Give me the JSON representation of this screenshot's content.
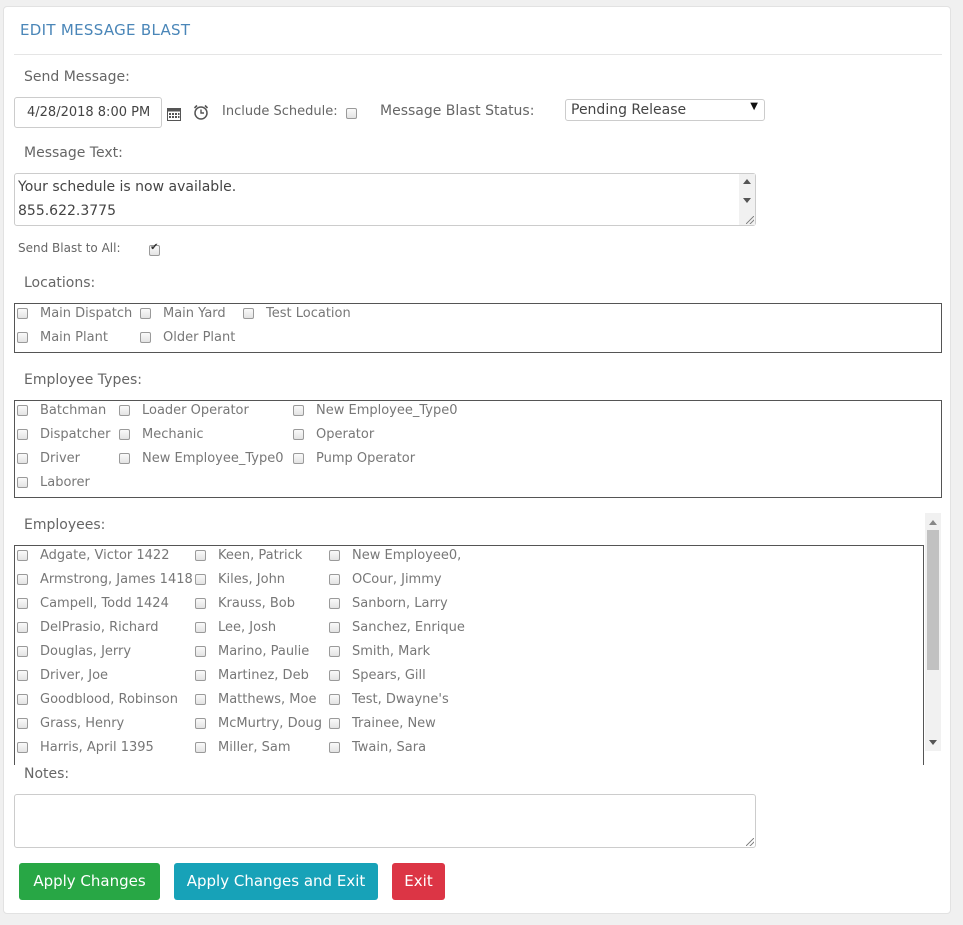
{
  "header": {
    "title": "EDIT MESSAGE BLAST"
  },
  "send_message": {
    "label": "Send Message:",
    "datetime_value": "4/28/2018 8:00 PM",
    "include_schedule_label": "Include Schedule:",
    "include_schedule_checked": false,
    "status_label": "Message Blast Status:",
    "status_value": "Pending Release"
  },
  "message_text": {
    "label": "Message Text:",
    "line1": "Your schedule is now available.",
    "line2": "855.622.3775"
  },
  "send_blast_all": {
    "label": "Send Blast to All:",
    "checked": true
  },
  "locations": {
    "label": "Locations:",
    "items": [
      "Main Dispatch",
      "Main Yard",
      "Test Location",
      "Main Plant",
      "Older Plant"
    ]
  },
  "employee_types": {
    "label": "Employee Types:",
    "items": [
      "Batchman",
      "Loader Operator",
      "New Employee_Type0",
      "Dispatcher",
      "Mechanic",
      "Operator",
      "Driver",
      "New Employee_Type0",
      "Pump Operator",
      "Laborer"
    ]
  },
  "employees": {
    "label": "Employees:",
    "items": [
      "Adgate, Victor 1422",
      "Keen, Patrick",
      "New Employee0,",
      "Armstrong, James 1418",
      "Kiles, John",
      "OCour, Jimmy",
      "Campell, Todd 1424",
      "Krauss, Bob",
      "Sanborn, Larry",
      "DelPrasio, Richard",
      "Lee, Josh",
      "Sanchez, Enrique",
      "Douglas, Jerry",
      "Marino, Paulie",
      "Smith, Mark",
      "Driver, Joe",
      "Martinez, Deb",
      "Spears, Gill",
      "Goodblood, Robinson",
      "Matthews, Moe",
      "Test, Dwayne's",
      "Grass, Henry",
      "McMurtry, Doug",
      "Trainee, New",
      "Harris, April 1395",
      "Miller, Sam",
      "Twain, Sara"
    ]
  },
  "notes": {
    "label": "Notes:",
    "value": ""
  },
  "buttons": {
    "apply": "Apply Changes",
    "apply_exit": "Apply Changes and Exit",
    "exit": "Exit"
  },
  "colors": {
    "title": "#4a86b8",
    "apply": "#28a745",
    "apply_exit": "#17a2b8",
    "exit": "#dc3545"
  }
}
